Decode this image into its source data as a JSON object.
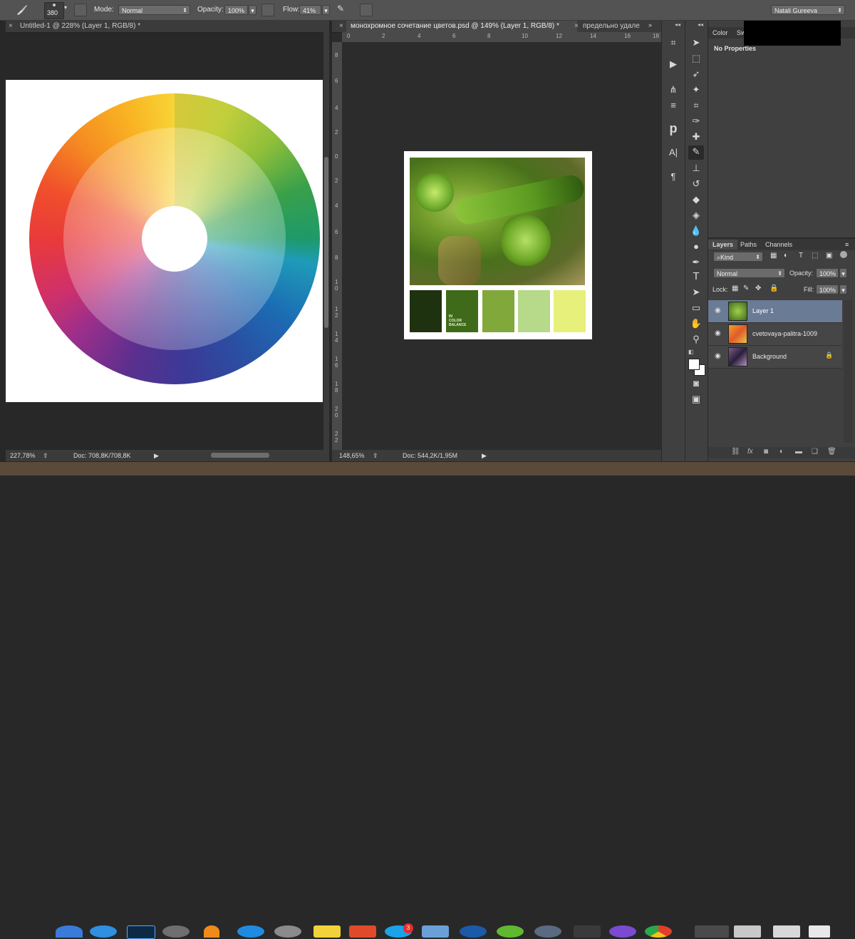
{
  "options_bar": {
    "brush_size": "380",
    "mode_label": "Mode:",
    "mode_value": "Normal",
    "opacity_label": "Opacity:",
    "opacity_value": "100%",
    "flow_label": "Flow:",
    "flow_value": "41%",
    "user_name": "Natali Gureeva"
  },
  "left_doc": {
    "tab_title": "Untitled-1 @ 228% (Layer 1, RGB/8) *",
    "zoom": "227,78%",
    "doc_info": "Doc: 708,8K/708,8K"
  },
  "right_doc": {
    "tabs": [
      {
        "label": "монохромное сочетание цветов.psd @ 149% (Layer 1, RGB/8) *"
      },
      {
        "label": "предельно удале"
      }
    ],
    "ruler_top": [
      "0",
      "2",
      "4",
      "6",
      "8",
      "10",
      "12",
      "14",
      "16",
      "18"
    ],
    "ruler_left": [
      "8",
      "6",
      "4",
      "2",
      "0",
      "2",
      "4",
      "6",
      "8",
      "1\n0",
      "1\n2",
      "1\n4",
      "1\n6",
      "1\n8",
      "2\n0",
      "2\n2"
    ],
    "zoom": "148,65%",
    "doc_info": "Doc: 544,2K/1,95M",
    "palette_text": "IN\nCOLOR\nBALANCE",
    "swatches": [
      "#1f3210",
      "#3f6a1a",
      "#80a83a",
      "#b6d98a",
      "#e7f07a"
    ]
  },
  "left_ruler": [
    "0",
    "2",
    "4",
    "6",
    "8",
    "1\n0",
    "1\n2",
    "1\n4",
    "1\n6",
    "1\n8",
    "2\n0"
  ],
  "properties_panel": {
    "tabs": [
      "Color",
      "Sw"
    ],
    "content": "No Properties"
  },
  "layers_panel": {
    "tabs": [
      "Layers",
      "Paths",
      "Channels"
    ],
    "kind": "Kind",
    "blend_mode": "Normal",
    "opacity_label": "Opacity:",
    "opacity_value": "100%",
    "lock_label": "Lock:",
    "fill_label": "Fill:",
    "fill_value": "100%",
    "layers": [
      {
        "name": "Layer 1",
        "selected": true
      },
      {
        "name": "cvetovaya-palitra-1009",
        "selected": false
      },
      {
        "name": "Background",
        "selected": false,
        "locked": true
      }
    ]
  },
  "dock_badge": "3",
  "icons": {
    "brush": "brush-icon",
    "move": "move-icon",
    "marquee": "marquee-icon",
    "lasso": "lasso-icon",
    "wand": "magic-wand-icon",
    "crop": "crop-icon",
    "eyedropper": "eyedropper-icon",
    "heal": "spot-healing-icon",
    "stamp": "clone-stamp-icon",
    "history": "history-brush-icon",
    "eraser": "eraser-icon",
    "bucket": "paint-bucket-icon",
    "blur": "blur-icon",
    "dodge": "dodge-icon",
    "pen": "pen-icon",
    "type": "type-icon",
    "path": "path-selection-icon",
    "shape": "rectangle-icon",
    "hand": "hand-icon",
    "zoom": "zoom-icon"
  },
  "colors": {
    "selected_layer": "#6a7b95",
    "foreground": "#ffffff",
    "background": "#ffffff"
  }
}
